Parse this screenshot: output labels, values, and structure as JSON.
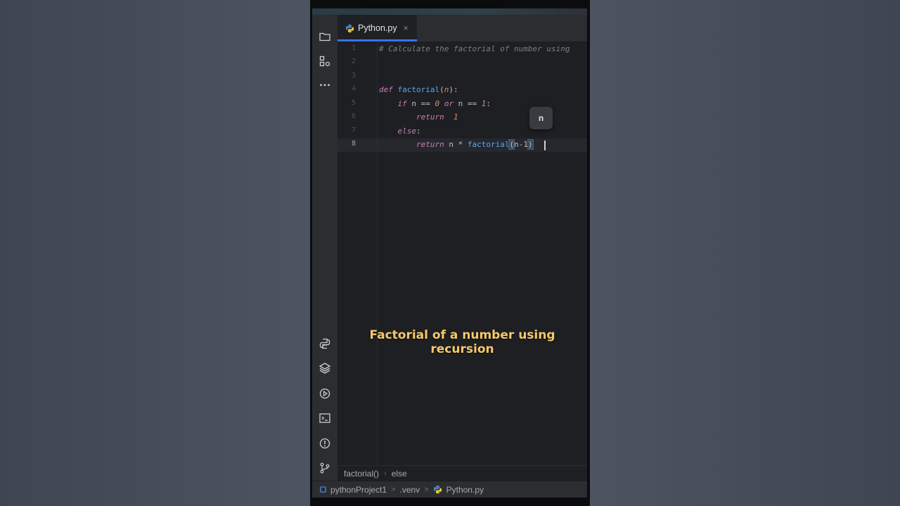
{
  "editor_tab": {
    "label": "Python.py",
    "close_glyph": "×",
    "icon": "python-logo-icon"
  },
  "tool_window_icons": [
    "folder-icon",
    "structure-icon",
    "more-icon",
    "python-console-icon",
    "layers-icon",
    "run-icon",
    "terminal-icon",
    "problems-icon",
    "git-icon"
  ],
  "line_numbers": [
    "1",
    "2",
    "3",
    "4",
    "5",
    "6",
    "7",
    "8"
  ],
  "active_line": "8",
  "code": {
    "line1": {
      "comment": "# Calculate the factorial of number using"
    },
    "line4": {
      "kw": "def",
      "fn": "factorial",
      "open": "(",
      "param": "n",
      "close": "):"
    },
    "line5": {
      "kw": "if",
      "a": "n",
      "eq1": "==",
      "zero": "0",
      "or": "or",
      "b": "n",
      "eq2": "==",
      "one": "1",
      "colon": ":"
    },
    "line6": {
      "kw": "return",
      "val": "1"
    },
    "line7": {
      "kw": "else",
      "colon": ":"
    },
    "line8": {
      "kw": "return",
      "a": "n",
      "star": "*",
      "fn": "factorial",
      "open": "(",
      "arg": "n-1",
      "close": ")"
    }
  },
  "param_hint": "n",
  "caption": "Factorial of a number using recursion",
  "breadcrumb": {
    "items": [
      "factorial()",
      "else"
    ],
    "separator": "›"
  },
  "statusbar": {
    "project": "pythonProject1",
    "venv": ".venv",
    "file": "Python.py",
    "separator": ">"
  },
  "colors": {
    "accent": "#3574f0",
    "caption": "#f6c86a",
    "background": "#1e1f22"
  }
}
